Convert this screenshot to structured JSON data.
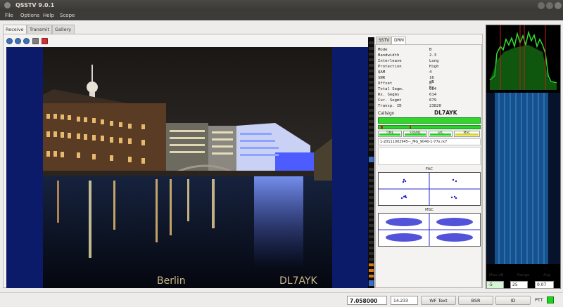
{
  "window": {
    "title": "QSSTV 9.0.1"
  },
  "menu": [
    "File",
    "Options",
    "Help",
    "Scope"
  ],
  "tabs": [
    "Receive",
    "Transmit",
    "Gallery"
  ],
  "toolbar": {
    "icons": [
      "help-icon",
      "back-icon",
      "stop-icon",
      "save-icon",
      "erase-icon"
    ]
  },
  "image": {
    "caption_left": "Berlin",
    "caption_right": "DL7AYK"
  },
  "drm": {
    "tabs": [
      "SSTV",
      "DRM"
    ],
    "fields": [
      {
        "key": "Mode",
        "value": "B"
      },
      {
        "key": "Bandwidth",
        "value": "2.3"
      },
      {
        "key": "Interleave",
        "value": "Long"
      },
      {
        "key": "Protection",
        "value": "High"
      },
      {
        "key": "QAM",
        "value": "4"
      },
      {
        "key": "SNR",
        "value": "16 dB"
      },
      {
        "key": "Offset",
        "value": "8 Hz"
      },
      {
        "key": "Total Segm.",
        "value": "684"
      },
      {
        "key": "Rx. Segms",
        "value": "614"
      },
      {
        "key": "Cur. Segmt",
        "value": "679"
      },
      {
        "key": "Transp. ID",
        "value": "23820"
      }
    ],
    "callsign_label": "Callsign",
    "callsign_value": "DL7AYK",
    "indicators": [
      "TIME",
      "FRAME",
      "FAC",
      "MSC"
    ],
    "filename": "1-20111002945--_MG_9040-1-77x.rx7",
    "fac_label": "FAC",
    "msc_label": "MSC"
  },
  "spectrum": {
    "labels": {
      "max_db": "Max dB",
      "range": "Range",
      "avg": "Avg"
    },
    "max_db_value": "-5",
    "range_value": "25",
    "avg_value": "0.07"
  },
  "status": {
    "frequency": "7.058000",
    "mode_value": "14.233",
    "buttons": [
      "WF Text",
      "BSR",
      "ID"
    ],
    "ptt_label": "PTT"
  }
}
